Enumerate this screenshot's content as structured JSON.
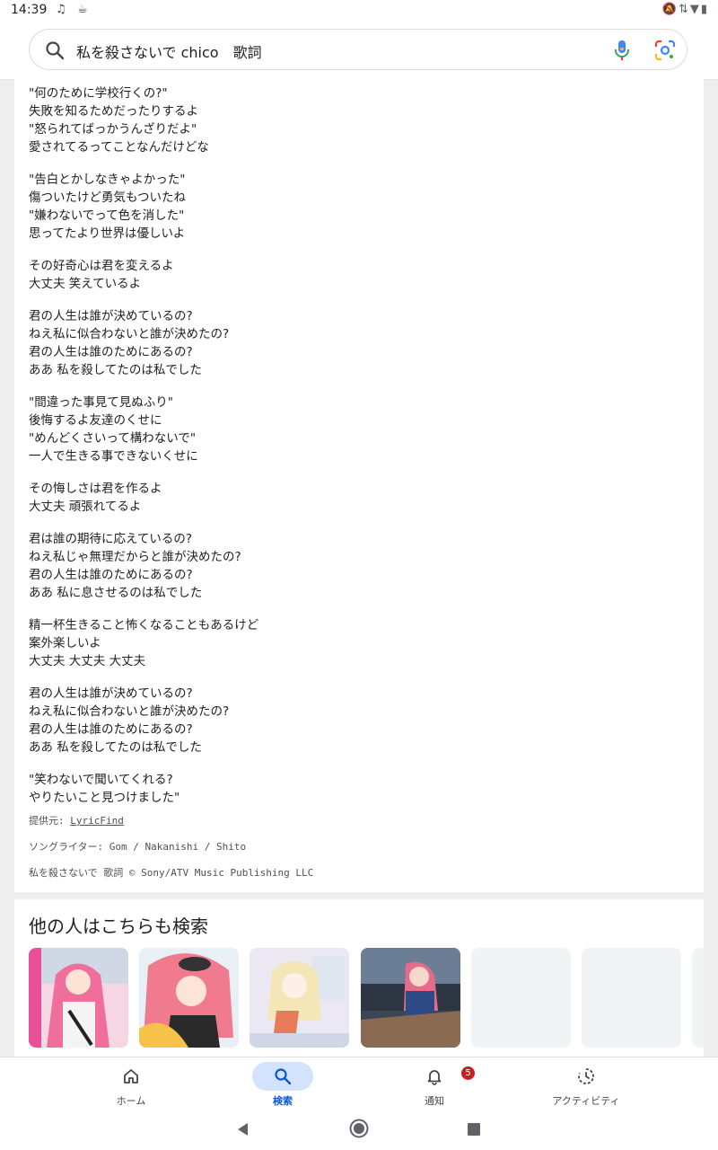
{
  "status_bar": {
    "time": "14:39",
    "left_icons": [
      "music-note-icon",
      "cup-icon"
    ],
    "right_icons": [
      "muted-bell-icon",
      "data-arrows-icon",
      "wifi-icon",
      "battery-icon"
    ]
  },
  "search": {
    "query": "私を殺さないで chico　歌詞"
  },
  "lyrics": {
    "stanzas": [
      [
        "\"何のために学校行くの?\"",
        "失敗を知るためだったりするよ",
        "\"怒られてばっかうんざりだよ\"",
        "愛されてるってことなんだけどな"
      ],
      [
        "\"告白とかしなきゃよかった\"",
        "傷ついたけど勇気もついたね",
        "\"嫌わないでって色を消した\"",
        "思ってたより世界は優しいよ"
      ],
      [
        "その好奇心は君を変えるよ",
        "大丈夫 笑えているよ"
      ],
      [
        "君の人生は誰が決めているの?",
        "ねえ私に似合わないと誰が決めたの?",
        "君の人生は誰のためにあるの?",
        "ああ 私を殺してたのは私でした"
      ],
      [
        "\"間違った事見て見ぬふり\"",
        "後悔するよ友達のくせに",
        "\"めんどくさいって構わないで\"",
        "一人で生きる事できないくせに"
      ],
      [
        "その悔しさは君を作るよ",
        "大丈夫 頑張れてるよ"
      ],
      [
        "君は誰の期待に応えているの?",
        "ねえ私じゃ無理だからと誰が決めたの?",
        "君の人生は誰のためにあるの?",
        "ああ 私に息させるのは私でした"
      ],
      [
        "精一杯生きること怖くなることもあるけど",
        "案外楽しいよ",
        "大丈夫 大丈夫 大丈夫"
      ],
      [
        "君の人生は誰が決めているの?",
        "ねえ私に似合わないと誰が決めたの?",
        "君の人生は誰のためにあるの?",
        "ああ 私を殺してたのは私でした"
      ],
      [
        "\"笑わないで聞いてくれる?",
        "やりたいこと見つけました\""
      ]
    ],
    "provider_prefix": "提供元: ",
    "provider_name": "LyricFind",
    "songwriters": "ソングライター: Gom / Nakanishi / Shito",
    "copyright": "私を殺さないで 歌詞 © Sony/ATV Music Publishing LLC"
  },
  "related": {
    "title": "他の人はこちらも検索"
  },
  "bottom_nav": {
    "items": [
      {
        "label": "ホーム",
        "icon": "home-icon",
        "active": false
      },
      {
        "label": "検索",
        "icon": "search-icon",
        "active": true
      },
      {
        "label": "通知",
        "icon": "bell-icon",
        "active": false,
        "badge": "5"
      },
      {
        "label": "アクティビティ",
        "icon": "activity-history-icon",
        "active": false
      }
    ]
  },
  "colors": {
    "accent": "#0b57d0",
    "active_pill": "#d3e3fd",
    "badge": "#c5221f",
    "background": "#eeeeee"
  }
}
